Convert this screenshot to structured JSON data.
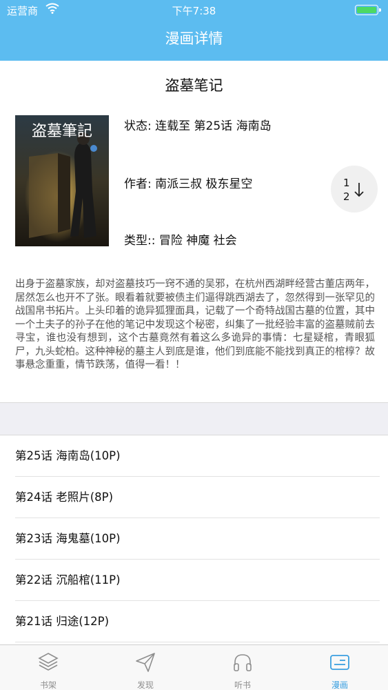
{
  "status_bar": {
    "carrier": "运营商",
    "time": "下午7:38"
  },
  "nav": {
    "title": "漫画详情"
  },
  "comic": {
    "title": "盗墓笔记",
    "status_label": "状态:",
    "status_value": "连载至 第25话 海南岛",
    "author_label": "作者:",
    "author_value": "南派三叔 极东星空",
    "genre_label": "类型::",
    "genre_value": "冒险 神魔 社会",
    "description": "出身于盗墓家族，却对盗墓技巧一窍不通的吴邪，在杭州西湖畔经营古董店两年，居然怎么也开不了张。眼看着就要被债主们逼得跳西湖去了，忽然得到一张罕见的战国帛书拓片。上头印着的诡异狐狸面具，记载了一个奇特战国古墓的位置，其中一个土夫子的孙子在他的笔记中发现这个秘密，纠集了一批经验丰富的盗墓贼前去寻宝，谁也没有想到，这个古墓竟然有着这么多诡异的事情：七星疑棺，青眼狐尸，九头蛇柏。这种神秘的墓主人到底是谁，他们到底能不能找到真正的棺椁？故事悬念重重，情节跌荡，值得一看！！",
    "cover_title": "盗墓筆記"
  },
  "sort_button": {
    "line1": "1",
    "line2": "2"
  },
  "chapters": [
    {
      "label": "第25话 海南岛(10P)"
    },
    {
      "label": "第24话 老照片(8P)"
    },
    {
      "label": "第23话 海鬼墓(10P)"
    },
    {
      "label": "第22话 沉船棺(11P)"
    },
    {
      "label": "第21话 归途(12P)"
    }
  ],
  "tabbar": [
    {
      "label": "书架",
      "icon": "layers-icon",
      "active": false
    },
    {
      "label": "发现",
      "icon": "paper-plane-icon",
      "active": false
    },
    {
      "label": "听书",
      "icon": "headphones-icon",
      "active": false
    },
    {
      "label": "漫画",
      "icon": "comic-card-icon",
      "active": true
    }
  ],
  "colors": {
    "nav_bg": "#5cbcf0",
    "active_tab": "#3a9fe0",
    "battery": "#4cd964"
  }
}
